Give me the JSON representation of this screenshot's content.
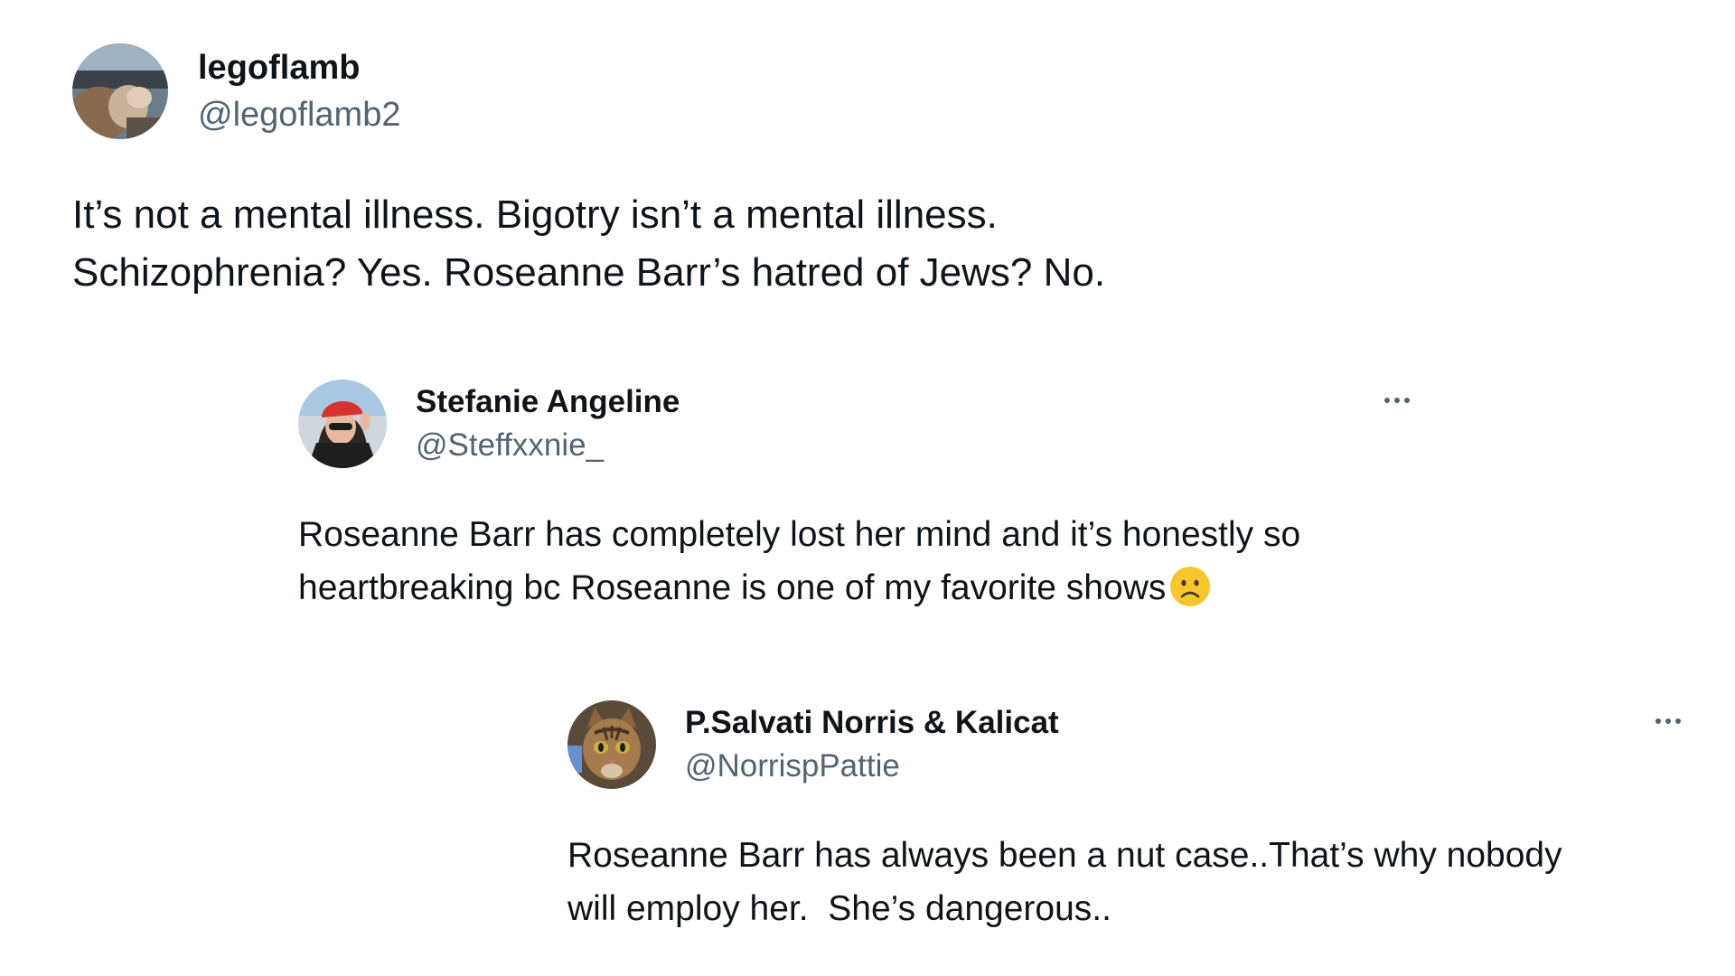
{
  "tweets": [
    {
      "display_name": "legoflamb",
      "handle": "@legoflamb2",
      "text_lines": [
        "It’s not a mental illness. Bigotry isn’t a mental illness.",
        "Schizophrenia? Yes. Roseanne Barr’s hatred of Jews? No."
      ],
      "avatar_icon": "person-in-car-avatar"
    },
    {
      "display_name": "Stefanie Angeline",
      "handle": "@Steffxxnie_",
      "text_lines": [
        "Roseanne Barr has completely lost her mind and it’s honestly so",
        "heartbreaking bc Roseanne is one of my favorite shows"
      ],
      "emoji": "slightly-frowning-face-icon",
      "avatar_icon": "woman-red-cap-avatar",
      "more_icon": "more-options-icon"
    },
    {
      "display_name": "P.Salvati Norris & Kalicat",
      "handle": "@NorrispPattie",
      "text_lines": [
        "Roseanne Barr has always been a nut case..That’s why nobody",
        "will employ her.  She’s dangerous.."
      ],
      "avatar_icon": "tabby-cat-avatar",
      "more_icon": "more-options-icon"
    }
  ],
  "colors": {
    "text_primary": "#0f1419",
    "text_secondary": "#536471",
    "background": "#ffffff",
    "emoji_yellow": "#f7c62f"
  }
}
